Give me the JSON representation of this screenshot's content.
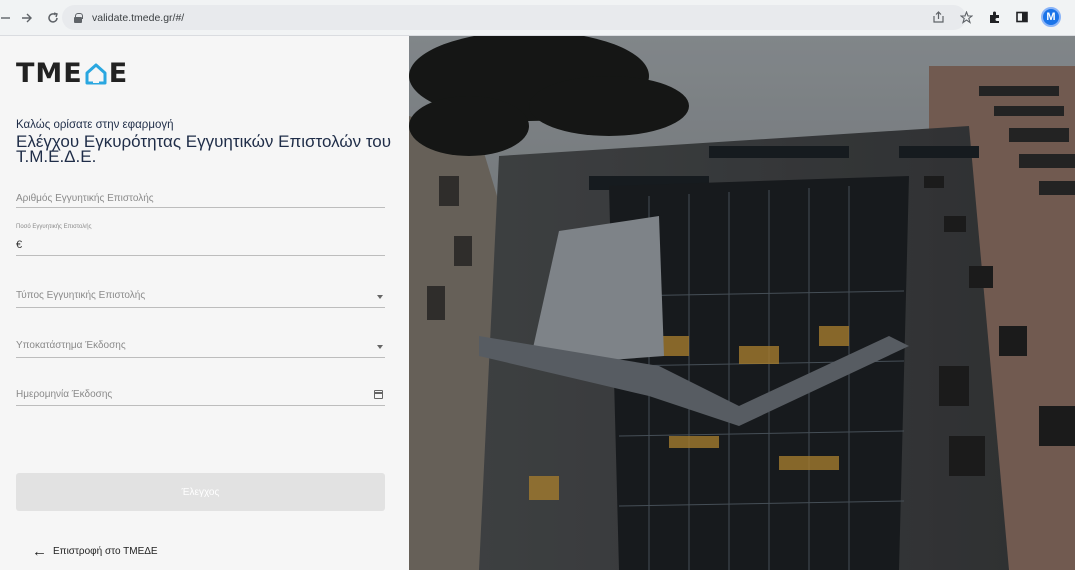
{
  "browser": {
    "url": "validate.tmede.gr/#/",
    "avatar_letter": "M"
  },
  "logo": {
    "left": "TME",
    "right": "E"
  },
  "welcome": "Καλώς ορίσατε στην εφαρμογή",
  "title": "Ελέγχου Εγκυρότητας Εγγυητικών Επιστολών του Τ.Μ.Ε.Δ.Ε.",
  "form": {
    "letter_number_placeholder": "Αριθμός Εγγυητικής Επιστολής",
    "amount_label": "Ποσό Εγγυητικής Επιστολής",
    "amount_value": "€",
    "type_placeholder": "Τύπος Εγγυητικής Επιστολής",
    "branch_placeholder": "Υποκατάστημα Έκδοσης",
    "date_placeholder": "Ημερομηνία Έκδοσης",
    "submit_label": "Έλεγχος"
  },
  "back_link": "Επιστροφή στο ΤΜΕΔΕ",
  "colors": {
    "title": "#1f2d48",
    "button": "#e2e2e2",
    "avatar": "#1a73e8"
  }
}
